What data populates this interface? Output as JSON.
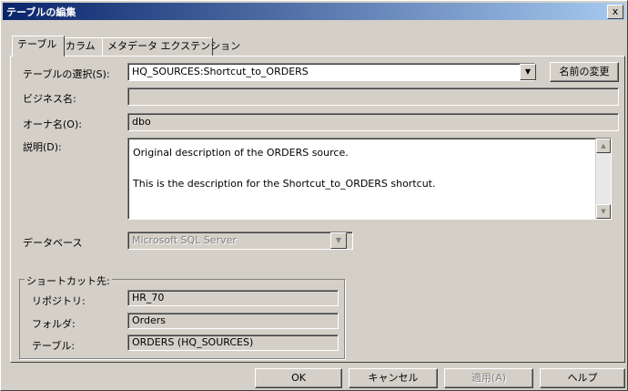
{
  "window": {
    "title": "テーブルの編集",
    "close": "x"
  },
  "tabs": [
    {
      "label": "テーブル"
    },
    {
      "label": "カラム"
    },
    {
      "label": "メタデータ エクステンション"
    }
  ],
  "form": {
    "select_table_label": "テーブルの選択(S):",
    "select_table_value": "HQ_SOURCES:Shortcut_to_ORDERS",
    "rename_button": "名前の変更",
    "business_name_label": "ビジネス名:",
    "business_name_value": "",
    "owner_label": "オーナ名(O):",
    "owner_value": "dbo",
    "description_label": "説明(D):",
    "description_line1": "Original description of the ORDERS source.",
    "description_line2": "This is the description for the Shortcut_to_ORDERS shortcut.",
    "database_label": "データベース",
    "database_value": "Microsoft SQL Server"
  },
  "shortcut_group": {
    "label": "ショートカット先:",
    "repository_label": "リポジトリ:",
    "repository_value": "HR_70",
    "folder_label": "フォルダ:",
    "folder_value": "Orders",
    "table_label": "テーブル:",
    "table_value": "ORDERS (HQ_SOURCES)"
  },
  "buttons": {
    "ok": "OK",
    "cancel": "キャンセル",
    "apply": "適用(A)",
    "help": "ヘルプ"
  },
  "icons": {
    "dropdown": "chevron-down-icon",
    "close": "close-icon"
  }
}
